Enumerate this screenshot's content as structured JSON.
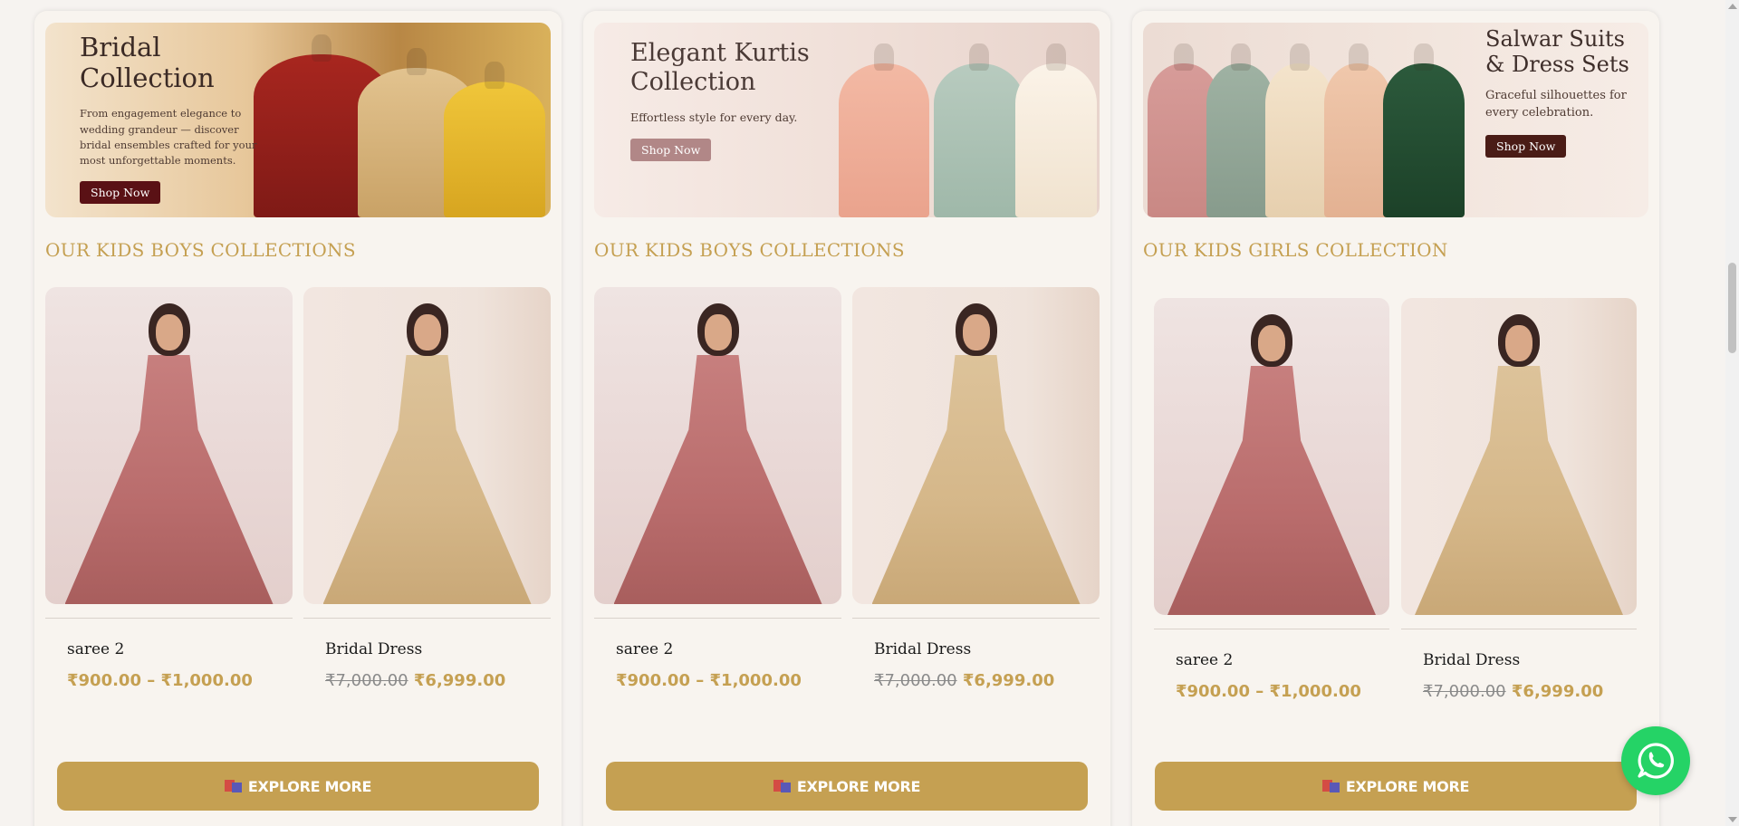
{
  "banners": [
    {
      "title_line1": "Bridal",
      "title_line2": "Collection",
      "subtitle": "From engagement elegance to wedding grandeur — discover bridal ensembles crafted for your most unforgettable moments.",
      "button": "Shop Now"
    },
    {
      "title_line1": "Elegant Kurtis",
      "title_line2": "Collection",
      "subtitle": "Effortless style for every day.",
      "button": "Shop Now"
    },
    {
      "title_line1": "Salwar Suits",
      "title_line2": "& Dress Sets",
      "subtitle": "Graceful silhouettes for every celebration.",
      "button": "Shop Now"
    }
  ],
  "sections": [
    {
      "title": "OUR KIDS BOYS COLLECTIONS",
      "products": [
        {
          "name": "saree 2",
          "price": "₹900.00 – ₹1,000.00"
        },
        {
          "name": "Bridal Dress",
          "old_price": "₹7,000.00",
          "price": "₹6,999.00"
        }
      ],
      "button": "EXPLORE MORE"
    },
    {
      "title": "OUR KIDS BOYS COLLECTIONS",
      "products": [
        {
          "name": "saree 2",
          "price": "₹900.00 – ₹1,000.00"
        },
        {
          "name": "Bridal Dress",
          "old_price": "₹7,000.00",
          "price": "₹6,999.00"
        }
      ],
      "button": "EXPLORE MORE"
    },
    {
      "title": "OUR KIDS GIRLS COLLECTION",
      "products": [
        {
          "name": "saree 2",
          "price": "₹900.00 – ₹1,000.00"
        },
        {
          "name": "Bridal Dress",
          "old_price": "₹7,000.00",
          "price": "₹6,999.00"
        }
      ],
      "button": "EXPLORE MORE"
    }
  ],
  "icons": {
    "explore": "shopping-bags-icon",
    "whatsapp": "whatsapp-icon"
  },
  "colors": {
    "accent_gold": "#c5a052",
    "whatsapp_green": "#25d366",
    "page_bg": "#f6f3f0"
  }
}
